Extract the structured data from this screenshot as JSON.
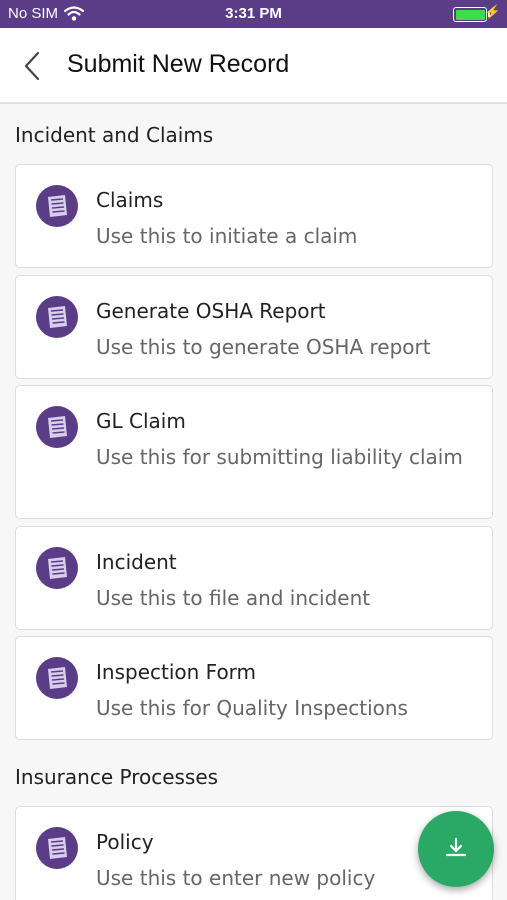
{
  "status_bar": {
    "carrier": "No SIM",
    "time": "3:31 PM",
    "battery_level": 1.0
  },
  "nav": {
    "title": "Submit New Record",
    "back_icon": "chevron-left-icon"
  },
  "sections": [
    {
      "title": "Incident and Claims",
      "items": [
        {
          "title": "Claims",
          "description": "Use this to initiate a claim"
        },
        {
          "title": "Generate OSHA Report",
          "description": "Use this to generate OSHA report"
        },
        {
          "title": "GL Claim",
          "description": "Use this for submitting liability claim"
        },
        {
          "title": "Incident",
          "description": "Use this to file and incident"
        },
        {
          "title": "Inspection Form",
          "description": "Use this for Quality Inspections"
        }
      ]
    },
    {
      "title": "Insurance Processes",
      "items": [
        {
          "title": "Policy",
          "description": "Use this to enter new policy"
        }
      ]
    }
  ],
  "colors": {
    "status_bar": "#5a3d86",
    "item_icon": "#5a3d86",
    "fab": "#2aa866"
  },
  "fab": {
    "icon": "download-icon"
  }
}
